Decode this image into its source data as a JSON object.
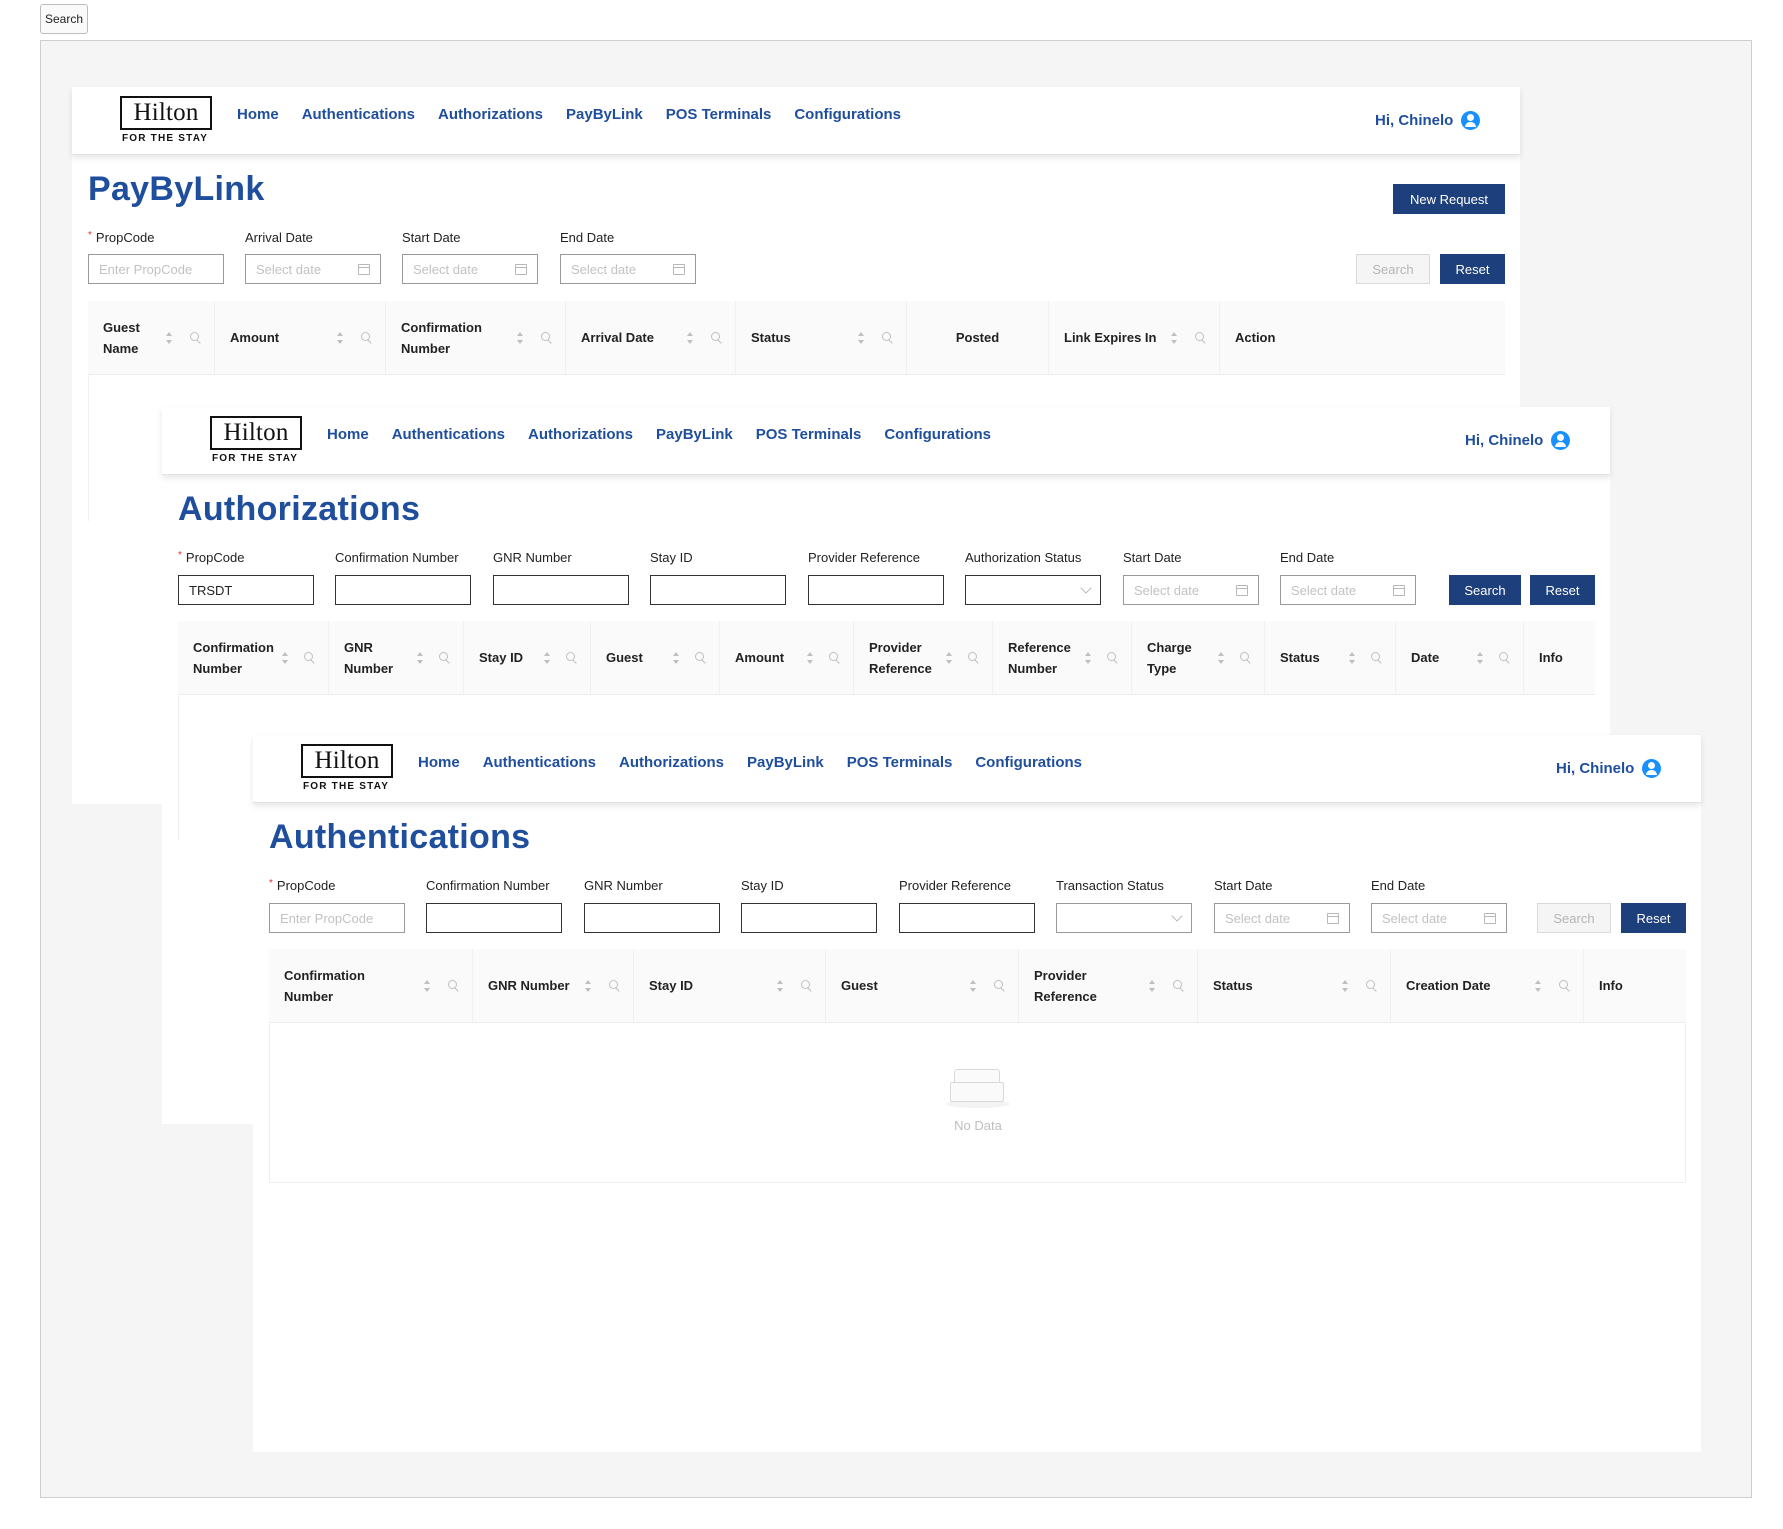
{
  "toolbar": {
    "search_label": "Search"
  },
  "nav": {
    "logo_word": "Hilton",
    "logo_tagline": "FOR THE STAY",
    "links": [
      "Home",
      "Authentications",
      "Authorizations",
      "PayByLink",
      "POS Terminals",
      "Configurations"
    ],
    "greeting": "Hi, Chinelo"
  },
  "paybylink": {
    "title": "PayByLink",
    "new_request": "New Request",
    "filters": {
      "propcode_label": "PropCode",
      "propcode_placeholder": "Enter PropCode",
      "arrival_label": "Arrival Date",
      "start_label": "Start Date",
      "end_label": "End Date",
      "date_placeholder": "Select date"
    },
    "search_label": "Search",
    "reset_label": "Reset",
    "columns": [
      "Guest\nName",
      "Amount",
      "Confirmation\nNumber",
      "Arrival Date",
      "Status",
      "Posted",
      "Link Expires In",
      "Action"
    ]
  },
  "authorizations": {
    "title": "Authorizations",
    "filters": {
      "propcode_label": "PropCode",
      "propcode_value": "TRSDT",
      "confirmation_label": "Confirmation Number",
      "gnr_label": "GNR Number",
      "stay_label": "Stay ID",
      "provider_label": "Provider Reference",
      "status_label": "Authorization Status",
      "start_label": "Start Date",
      "end_label": "End Date",
      "date_placeholder": "Select date"
    },
    "search_label": "Search",
    "reset_label": "Reset",
    "columns": [
      "Confirmation\nNumber",
      "GNR\nNumber",
      "Stay ID",
      "Guest",
      "Amount",
      "Provider\nReference",
      "Reference\nNumber",
      "Charge\nType",
      "Status",
      "Date",
      "Info"
    ]
  },
  "authentications": {
    "title": "Authentications",
    "filters": {
      "propcode_label": "PropCode",
      "propcode_placeholder": "Enter PropCode",
      "confirmation_label": "Confirmation Number",
      "gnr_label": "GNR Number",
      "stay_label": "Stay ID",
      "provider_label": "Provider Reference",
      "status_label": "Transaction Status",
      "start_label": "Start Date",
      "end_label": "End Date",
      "date_placeholder": "Select date"
    },
    "search_label": "Search",
    "reset_label": "Reset",
    "columns": [
      "Confirmation\nNumber",
      "GNR Number",
      "Stay ID",
      "Guest",
      "Provider\nReference",
      "Status",
      "Creation Date",
      "Info"
    ],
    "empty_text": "No Data"
  },
  "colors": {
    "brand_blue": "#1f4e9c",
    "button_navy": "#1d3f7c",
    "user_icon": "#1890ff"
  }
}
